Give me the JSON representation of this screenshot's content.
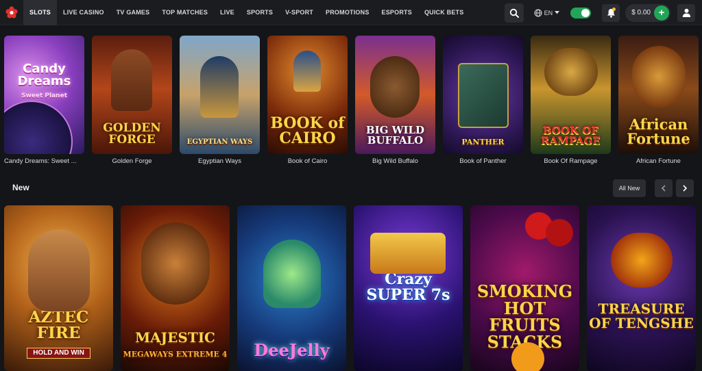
{
  "nav": {
    "items": [
      {
        "label": "SLOTS"
      },
      {
        "label": "LIVE CASINO"
      },
      {
        "label": "TV GAMES"
      },
      {
        "label": "TOP MATCHES"
      },
      {
        "label": "LIVE"
      },
      {
        "label": "SPORTS"
      },
      {
        "label": "V-SPORT"
      },
      {
        "label": "PROMOTIONS"
      },
      {
        "label": "ESPORTS"
      },
      {
        "label": "QUICK BETS"
      }
    ],
    "active": "SLOTS"
  },
  "header": {
    "language": "EN",
    "balance": "$ 0.00",
    "icons": {
      "logo": "flower-logo-icon",
      "search": "search-icon",
      "globe": "globe-icon",
      "bell": "bell-icon",
      "user": "user-icon",
      "plus": "plus-icon"
    }
  },
  "colors": {
    "accent_green": "#21a558",
    "background": "#141518",
    "topbar": "#1b1c20",
    "button": "#2b2d33",
    "logo_red": "#e0322b"
  },
  "top_games": [
    {
      "caption": "Candy Dreams: Sweet ...",
      "art_text": "Candy Dreams",
      "art_sub": "Sweet Planet"
    },
    {
      "caption": "Golden Forge",
      "art_text": "GOLDEN FORGE"
    },
    {
      "caption": "Egyptian Ways",
      "art_text": "EGYPTIAN WAYS"
    },
    {
      "caption": "Book of Cairo",
      "art_text": "BOOK of CAIRO"
    },
    {
      "caption": "Big Wild Buffalo",
      "art_text": "BIG WILD BUFFALO"
    },
    {
      "caption": "Book of Panther",
      "art_text": "PANTHER"
    },
    {
      "caption": "Book Of Rampage",
      "art_text": "BOOK OF RAMPAGE"
    },
    {
      "caption": "African Fortune",
      "art_text": "African Fortune"
    }
  ],
  "new_section": {
    "title": "New",
    "all_label": "All New",
    "prev_icon": "chevron-left-icon",
    "next_icon": "chevron-right-icon",
    "games": [
      {
        "art_text": "AZTEC FIRE",
        "art_sub": "HOLD AND WIN"
      },
      {
        "art_text": "MAJESTIC",
        "art_sub": "MEGAWAYS EXTREME 4"
      },
      {
        "art_text": "DeeJelly"
      },
      {
        "art_text": "Crazy SUPER 7s"
      },
      {
        "art_text": "SMOKING HOT FRUITS STACKS"
      },
      {
        "art_text": "TREASURE OF TENGSHE"
      }
    ]
  }
}
